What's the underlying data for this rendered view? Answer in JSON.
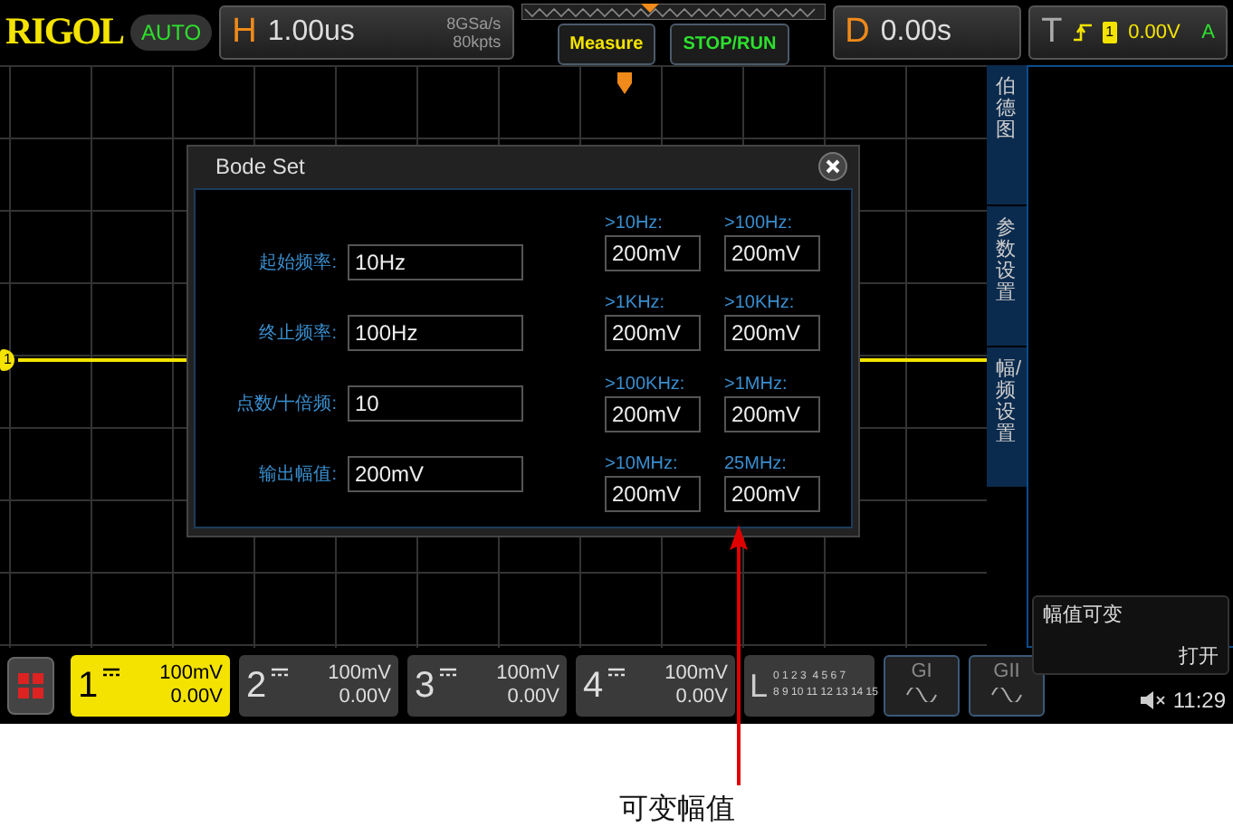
{
  "top_bar": {
    "logo": "RIGOL",
    "mode": "AUTO",
    "horizontal": {
      "label": "H",
      "timebase": "1.00us",
      "sample_rate": "8GSa/s",
      "memory_depth": "80kpts"
    },
    "buttons": [
      {
        "label": "Measure",
        "kind": "measure"
      },
      {
        "label": "STOP/RUN",
        "kind": "run"
      }
    ],
    "delay": {
      "label": "D",
      "value": "0.00s"
    },
    "trigger": {
      "label": "T",
      "source": "1",
      "level": "0.00V",
      "mode": "A"
    }
  },
  "waveform": {
    "channel_marker": "1"
  },
  "dialog": {
    "title": "Bode Set",
    "settings": [
      {
        "label": "起始频率:",
        "value": "10Hz"
      },
      {
        "label": "终止频率:",
        "value": "100Hz"
      },
      {
        "label": "点数/十倍频:",
        "value": "10"
      },
      {
        "label": "输出幅值:",
        "value": "200mV"
      }
    ],
    "amplitudes": [
      {
        "label": ">10Hz:",
        "value": "200mV"
      },
      {
        "label": ">100Hz:",
        "value": "200mV"
      },
      {
        "label": ">1KHz:",
        "value": "200mV"
      },
      {
        "label": ">10KHz:",
        "value": "200mV"
      },
      {
        "label": ">100KHz:",
        "value": "200mV"
      },
      {
        "label": ">1MHz:",
        "value": "200mV"
      },
      {
        "label": ">10MHz:",
        "value": "200mV"
      },
      {
        "label": "25MHz:",
        "value": "200mV"
      }
    ]
  },
  "side_menu": {
    "tabs": [
      {
        "label": "伯德图",
        "selected": false
      },
      {
        "label": "参数设置",
        "selected": false
      },
      {
        "label": "幅/频设置",
        "selected": false
      }
    ],
    "softkey": {
      "title": "幅值可变",
      "value": "打开"
    }
  },
  "bottom_bar": {
    "channels": [
      {
        "number": "1",
        "scale": "100mV",
        "offset": "0.00V",
        "active": true
      },
      {
        "number": "2",
        "scale": "100mV",
        "offset": "0.00V",
        "active": false
      },
      {
        "number": "3",
        "scale": "100mV",
        "offset": "0.00V",
        "active": false
      },
      {
        "number": "4",
        "scale": "100mV",
        "offset": "0.00V",
        "active": false
      }
    ],
    "logic": {
      "label": "L",
      "rows": [
        "0 1 2 3  4 5 6 7",
        "8 9 10 11 12 13 14 15"
      ]
    },
    "generators": [
      {
        "label": "GI"
      },
      {
        "label": "GII"
      }
    ],
    "time": "11:29"
  },
  "annotation": {
    "text": "可变幅值"
  }
}
